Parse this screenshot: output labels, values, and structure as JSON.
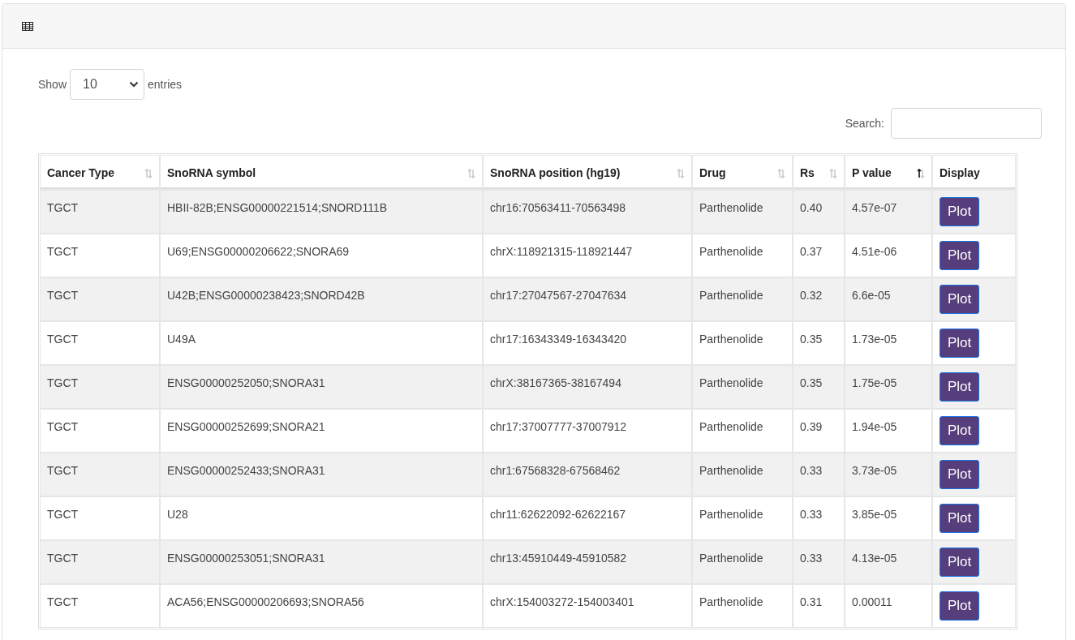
{
  "length_control": {
    "label_before": "Show",
    "value": "10",
    "label_after": "entries"
  },
  "search": {
    "label": "Search:"
  },
  "table": {
    "columns": [
      {
        "label": "Cancer Type",
        "sortable": true,
        "sorted_ascending": false
      },
      {
        "label": "SnoRNA symbol",
        "sortable": true,
        "sorted_ascending": false
      },
      {
        "label": "SnoRNA position (hg19)",
        "sortable": true,
        "sorted_ascending": false
      },
      {
        "label": "Drug",
        "sortable": true,
        "sorted_ascending": false
      },
      {
        "label": "Rs",
        "sortable": true,
        "sorted_ascending": false
      },
      {
        "label": "P value",
        "sortable": true,
        "sorted_ascending": true
      },
      {
        "label": "Display",
        "sortable": false
      }
    ],
    "rows": [
      {
        "cells": [
          "TGCT",
          "HBII-82B;ENSG00000221514;SNORD111B",
          "chr16:70563411-70563498",
          "Parthenolide",
          "0.40",
          "4.57e-07"
        ],
        "button": "Plot"
      },
      {
        "cells": [
          "TGCT",
          "U69;ENSG00000206622;SNORA69",
          "chrX:118921315-118921447",
          "Parthenolide",
          "0.37",
          "4.51e-06"
        ],
        "button": "Plot"
      },
      {
        "cells": [
          "TGCT",
          "U42B;ENSG00000238423;SNORD42B",
          "chr17:27047567-27047634",
          "Parthenolide",
          "0.32",
          "6.6e-05"
        ],
        "button": "Plot"
      },
      {
        "cells": [
          "TGCT",
          "U49A",
          "chr17:16343349-16343420",
          "Parthenolide",
          "0.35",
          "1.73e-05"
        ],
        "button": "Plot"
      },
      {
        "cells": [
          "TGCT",
          "ENSG00000252050;SNORA31",
          "chrX:38167365-38167494",
          "Parthenolide",
          "0.35",
          "1.75e-05"
        ],
        "button": "Plot"
      },
      {
        "cells": [
          "TGCT",
          "ENSG00000252699;SNORA21",
          "chr17:37007777-37007912",
          "Parthenolide",
          "0.39",
          "1.94e-05"
        ],
        "button": "Plot"
      },
      {
        "cells": [
          "TGCT",
          "ENSG00000252433;SNORA31",
          "chr1:67568328-67568462",
          "Parthenolide",
          "0.33",
          "3.73e-05"
        ],
        "button": "Plot"
      },
      {
        "cells": [
          "TGCT",
          "U28",
          "chr11:62622092-62622167",
          "Parthenolide",
          "0.33",
          "3.85e-05"
        ],
        "button": "Plot"
      },
      {
        "cells": [
          "TGCT",
          "ENSG00000253051;SNORA31",
          "chr13:45910449-45910582",
          "Parthenolide",
          "0.33",
          "4.13e-05"
        ],
        "button": "Plot"
      },
      {
        "cells": [
          "TGCT",
          "ACA56;ENSG00000206693;SNORA56",
          "chrX:154003272-154003401",
          "Parthenolide",
          "0.31",
          "0.00011"
        ],
        "button": "Plot"
      }
    ]
  }
}
